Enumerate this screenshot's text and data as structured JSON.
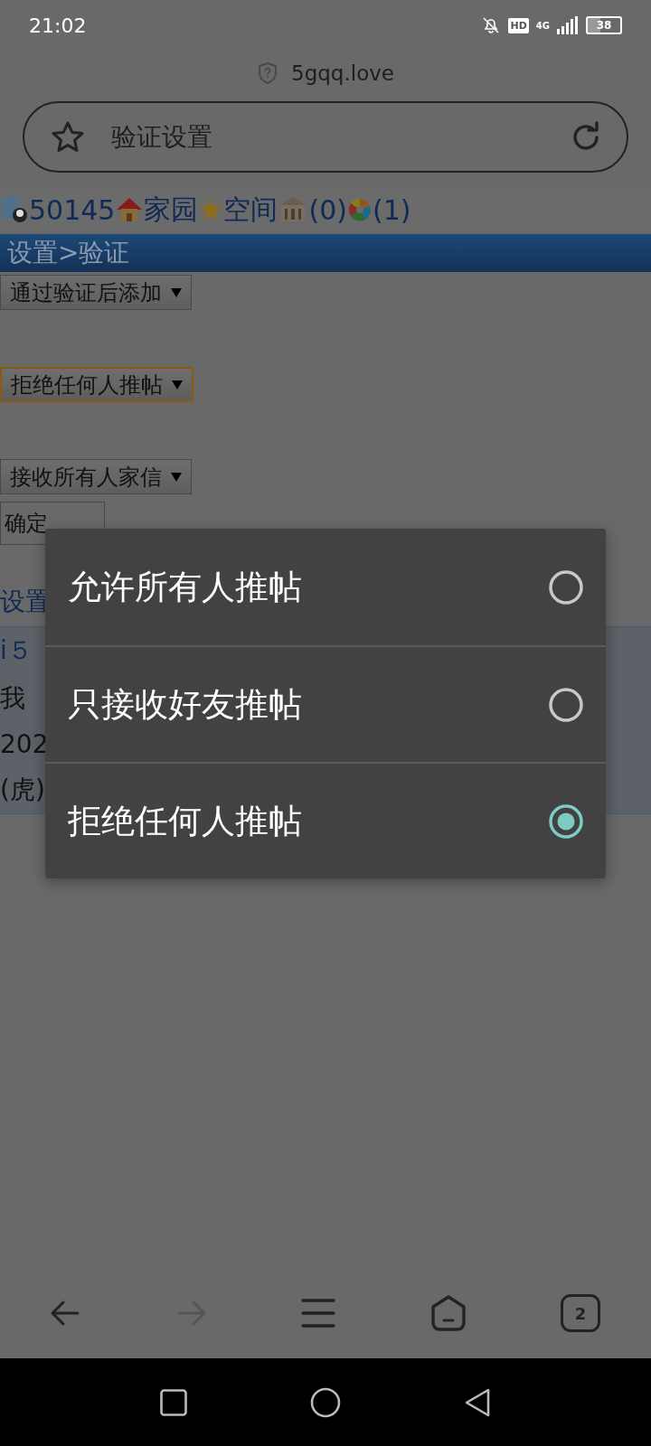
{
  "status_bar": {
    "time": "21:02",
    "network_badge": "HD",
    "network_type": "4G",
    "battery": "38"
  },
  "browser": {
    "host": "5gqq.love",
    "address_title": "验证设置"
  },
  "page": {
    "nav_links": [
      {
        "kind": "user",
        "label": "50145"
      },
      {
        "kind": "home",
        "label": "家园"
      },
      {
        "kind": "star",
        "label": "空间"
      },
      {
        "kind": "building",
        "label": "(0)"
      },
      {
        "kind": "wheel",
        "label": "(1)"
      }
    ],
    "header": "设置>验证",
    "selects": [
      {
        "value": "通过验证后添加",
        "focused": false
      },
      {
        "value": "拒绝任何人推帖",
        "focused": true
      },
      {
        "value": "接收所有人家信",
        "focused": false
      }
    ],
    "submit_button": "确定",
    "footer_link": "设置",
    "panel_lines": [
      {
        "kind": "link",
        "text": "i５"
      },
      {
        "kind": "text",
        "text": "我"
      },
      {
        "kind": "text",
        "text": "202"
      },
      {
        "kind": "text",
        "text": "(虎)"
      }
    ]
  },
  "dialog": {
    "options": [
      {
        "label": "允许所有人推帖",
        "selected": false
      },
      {
        "label": "只接收好友推帖",
        "selected": false
      },
      {
        "label": "拒绝任何人推帖",
        "selected": true
      }
    ]
  },
  "bottom_nav": {
    "tab_count": "2",
    "forward_disabled": true
  }
}
